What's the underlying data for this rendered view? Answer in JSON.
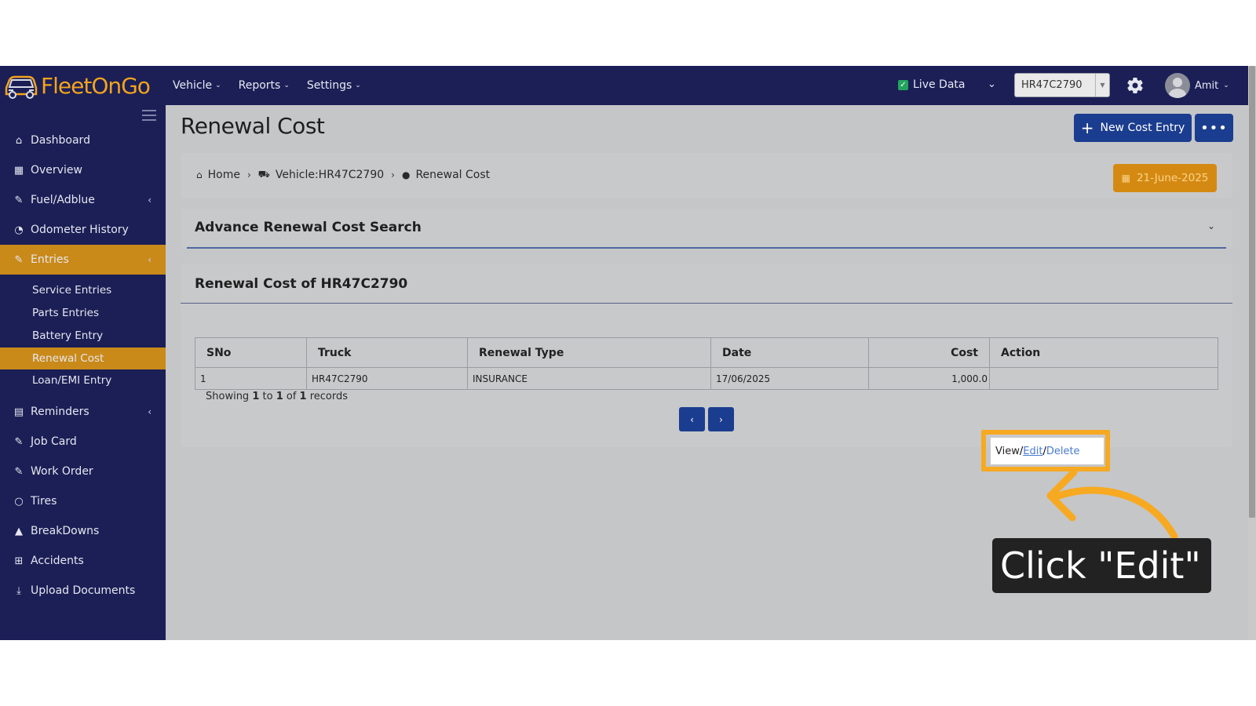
{
  "app": {
    "brand": {
      "part1": "Fleet",
      "part2": "OnGo"
    }
  },
  "nav": {
    "items": [
      {
        "label": "Vehicle"
      },
      {
        "label": "Reports"
      },
      {
        "label": "Settings"
      }
    ],
    "live_data_label": "Live Data",
    "truck_selected": "HR47C2790",
    "user_name": "Amit"
  },
  "sidebar": {
    "items": [
      {
        "label": "Dashboard",
        "icon": "home-icon"
      },
      {
        "label": "Overview",
        "icon": "grid-icon"
      },
      {
        "label": "Fuel/Adblue",
        "icon": "edit-icon"
      },
      {
        "label": "Odometer History",
        "icon": "gauge-icon"
      },
      {
        "label": "Entries",
        "icon": "edit-icon"
      },
      {
        "label": "Reminders",
        "icon": "calendar-icon"
      },
      {
        "label": "Job Card",
        "icon": "edit-icon"
      },
      {
        "label": "Work Order",
        "icon": "edit-icon"
      },
      {
        "label": "Tires",
        "icon": "circle-icon"
      },
      {
        "label": "BreakDowns",
        "icon": "warning-icon"
      },
      {
        "label": "Accidents",
        "icon": "plus-square-icon"
      },
      {
        "label": "Upload Documents",
        "icon": "download-icon"
      }
    ],
    "sub_items": [
      {
        "label": "Service Entries"
      },
      {
        "label": "Parts Entries"
      },
      {
        "label": "Battery Entry"
      },
      {
        "label": "Renewal Cost"
      },
      {
        "label": "Loan/EMI Entry"
      }
    ]
  },
  "page": {
    "title": "Renewal Cost",
    "new_button": "New Cost Entry",
    "more_button": "•••",
    "breadcrumb": {
      "home": "Home",
      "vehicle": "Vehicle:HR47C2790",
      "current": "Renewal Cost"
    },
    "date_button": "21-June-2025",
    "search_title": "Advance Renewal Cost Search",
    "card_title": "Renewal Cost of HR47C2790"
  },
  "table": {
    "headers": {
      "sno": "SNo",
      "truck": "Truck",
      "type": "Renewal Type",
      "date": "Date",
      "cost": "Cost",
      "action": "Action"
    },
    "rows": [
      {
        "sno": "1",
        "truck": "HR47C2790",
        "type": "INSURANCE",
        "date": "17/06/2025",
        "cost": "1,000.0"
      }
    ],
    "actions": {
      "view": "View",
      "edit": "Edit",
      "delete": "Delete"
    },
    "showing": {
      "prefix": "Showing ",
      "from": "1",
      "to_word": " to ",
      "to": "1",
      "of_word": " of ",
      "total": "1",
      "suffix": " records"
    },
    "pager": {
      "prev": "‹",
      "next": "›"
    }
  },
  "annotation": {
    "callout_text": "Click \"Edit\"",
    "accent_color": "#f7a921"
  },
  "colors": {
    "navy": "#1b1f56",
    "primary_button": "#1b3d8f",
    "active_orange": "#c98a1a"
  }
}
